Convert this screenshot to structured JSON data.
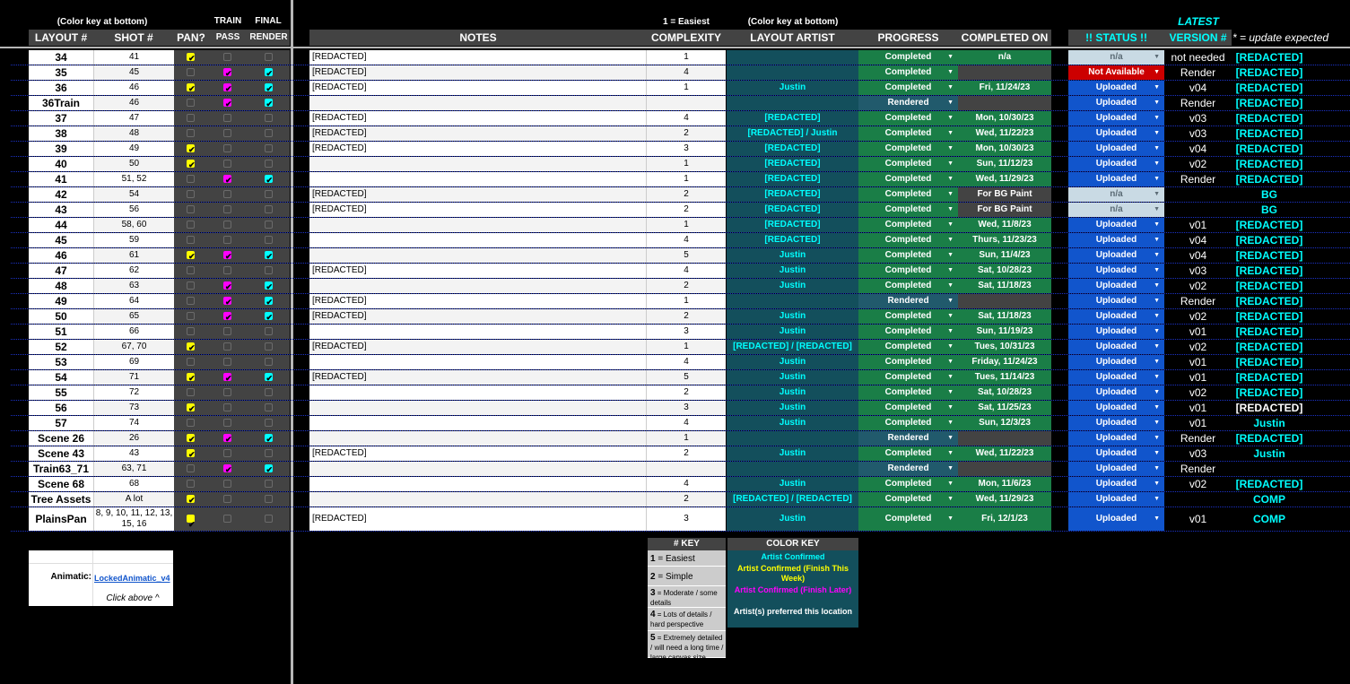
{
  "subheaders": {
    "color_key_left": "(Color key at bottom)",
    "train": "TRAIN",
    "final": "FINAL",
    "easiest": "1 = Easiest",
    "color_key_right": "(Color key at bottom)",
    "latest": "LATEST"
  },
  "headers": {
    "layout": "LAYOUT #",
    "shot": "SHOT #",
    "pan": "PAN?",
    "pass": "PASS",
    "render": "RENDER",
    "notes": "NOTES",
    "complexity": "COMPLEXITY",
    "artist": "LAYOUT ARTIST",
    "progress": "PROGRESS",
    "completed_on": "COMPLETED ON",
    "status": "!! STATUS !!",
    "version": "VERSION #",
    "update_note": "* = update expected"
  },
  "colors": {
    "green": "#1a7e47",
    "slate": "#215a6c",
    "dark": "#434343",
    "blue": "#1155cc",
    "red": "#cc0000",
    "light": "#c9dae4",
    "teal": "#134f5c",
    "cyan": "#00ffff",
    "yellow": "#ffff00",
    "magenta": "#ff00ff"
  },
  "rows": [
    {
      "layout": "34",
      "shot": "41",
      "pan": true,
      "train": false,
      "final": false,
      "notes": "[REDACTED]",
      "cx": "1",
      "artist": "",
      "progress": "Completed",
      "comp": "n/a",
      "comp_style": "green",
      "status": "n/a",
      "status_style": "light",
      "ver": "not needed",
      "extra": "[REDACTED]"
    },
    {
      "layout": "35",
      "shot": "45",
      "pan": false,
      "train": true,
      "final": true,
      "notes": "[REDACTED]",
      "cx": "4",
      "artist": "",
      "progress": "Completed",
      "comp": "",
      "comp_style": "dark",
      "status": "Not Available",
      "status_style": "red",
      "ver": "Render",
      "extra": "[REDACTED]"
    },
    {
      "layout": "36",
      "shot": "46",
      "pan": true,
      "train": true,
      "final": true,
      "notes": "[REDACTED]",
      "cx": "1",
      "artist": "Justin",
      "progress": "Completed",
      "comp": "Fri, 11/24/23",
      "comp_style": "green",
      "status": "Uploaded",
      "status_style": "blue",
      "ver": "v04",
      "extra": "[REDACTED]"
    },
    {
      "layout": "36Train",
      "shot": "46",
      "pan": false,
      "train": true,
      "final": true,
      "notes": "",
      "cx": "",
      "artist": "",
      "progress": "Rendered",
      "comp": "",
      "comp_style": "dark",
      "status": "Uploaded",
      "status_style": "blue",
      "ver": "Render",
      "extra": "[REDACTED]"
    },
    {
      "layout": "37",
      "shot": "47",
      "pan": false,
      "train": false,
      "final": false,
      "notes": "[REDACTED]",
      "cx": "4",
      "artist": "[REDACTED]",
      "progress": "Completed",
      "comp": "Mon, 10/30/23",
      "comp_style": "green",
      "status": "Uploaded",
      "status_style": "blue",
      "ver": "v03",
      "extra": "[REDACTED]"
    },
    {
      "layout": "38",
      "shot": "48",
      "pan": false,
      "train": false,
      "final": false,
      "notes": "[REDACTED]",
      "cx": "2",
      "artist": "[REDACTED] / Justin",
      "progress": "Completed",
      "comp": "Wed, 11/22/23",
      "comp_style": "green",
      "status": "Uploaded",
      "status_style": "blue",
      "ver": "v03",
      "extra": "[REDACTED]"
    },
    {
      "layout": "39",
      "shot": "49",
      "pan": true,
      "train": false,
      "final": false,
      "notes": "[REDACTED]",
      "cx": "3",
      "artist": "[REDACTED]",
      "progress": "Completed",
      "comp": "Mon, 10/30/23",
      "comp_style": "green",
      "status": "Uploaded",
      "status_style": "blue",
      "ver": "v04",
      "extra": "[REDACTED]"
    },
    {
      "layout": "40",
      "shot": "50",
      "pan": true,
      "train": false,
      "final": false,
      "notes": "",
      "cx": "1",
      "artist": "[REDACTED]",
      "progress": "Completed",
      "comp": "Sun, 11/12/23",
      "comp_style": "green",
      "status": "Uploaded",
      "status_style": "blue",
      "ver": "v02",
      "extra": "[REDACTED]"
    },
    {
      "layout": "41",
      "shot": "51, 52",
      "pan": false,
      "train": true,
      "final": true,
      "notes": "",
      "cx": "1",
      "artist": "[REDACTED]",
      "progress": "Completed",
      "comp": "Wed, 11/29/23",
      "comp_style": "green",
      "status": "Uploaded",
      "status_style": "blue",
      "ver": "Render",
      "extra": "[REDACTED]"
    },
    {
      "layout": "42",
      "shot": "54",
      "pan": false,
      "train": false,
      "final": false,
      "notes": "[REDACTED]",
      "cx": "2",
      "artist": "[REDACTED]",
      "progress": "Completed",
      "comp": "For BG Paint",
      "comp_style": "dark",
      "status": "n/a",
      "status_style": "light",
      "ver": "",
      "extra": "BG"
    },
    {
      "layout": "43",
      "shot": "56",
      "pan": false,
      "train": false,
      "final": false,
      "notes": "[REDACTED]",
      "cx": "2",
      "artist": "[REDACTED]",
      "progress": "Completed",
      "comp": "For BG Paint",
      "comp_style": "dark",
      "status": "n/a",
      "status_style": "light",
      "ver": "",
      "extra": "BG"
    },
    {
      "layout": "44",
      "shot": "58, 60",
      "pan": false,
      "train": false,
      "final": false,
      "notes": "",
      "cx": "1",
      "artist": "[REDACTED]",
      "progress": "Completed",
      "comp": "Wed, 11/8/23",
      "comp_style": "green",
      "status": "Uploaded",
      "status_style": "blue",
      "ver": "v01",
      "extra": "[REDACTED]"
    },
    {
      "layout": "45",
      "shot": "59",
      "pan": false,
      "train": false,
      "final": false,
      "notes": "",
      "cx": "4",
      "artist": "[REDACTED]",
      "progress": "Completed",
      "comp": "Thurs, 11/23/23",
      "comp_style": "green",
      "status": "Uploaded",
      "status_style": "blue",
      "ver": "v04",
      "extra": "[REDACTED]"
    },
    {
      "layout": "46",
      "shot": "61",
      "pan": true,
      "train": true,
      "final": true,
      "notes": "",
      "cx": "5",
      "artist": "Justin",
      "progress": "Completed",
      "comp": "Sun, 11/4/23",
      "comp_style": "green",
      "status": "Uploaded",
      "status_style": "blue",
      "ver": "v04",
      "extra": "[REDACTED]"
    },
    {
      "layout": "47",
      "shot": "62",
      "pan": false,
      "train": false,
      "final": false,
      "notes": "[REDACTED]",
      "cx": "4",
      "artist": "Justin",
      "progress": "Completed",
      "comp": "Sat, 10/28/23",
      "comp_style": "green",
      "status": "Uploaded",
      "status_style": "blue",
      "ver": "v03",
      "extra": "[REDACTED]"
    },
    {
      "layout": "48",
      "shot": "63",
      "pan": false,
      "train": true,
      "final": true,
      "notes": "",
      "cx": "2",
      "artist": "Justin",
      "progress": "Completed",
      "comp": "Sat, 11/18/23",
      "comp_style": "green",
      "status": "Uploaded",
      "status_style": "blue",
      "ver": "v02",
      "extra": "[REDACTED]"
    },
    {
      "layout": "49",
      "shot": "64",
      "pan": false,
      "train": true,
      "final": true,
      "notes": "[REDACTED]",
      "cx": "1",
      "artist": "",
      "progress": "Rendered",
      "comp": "",
      "comp_style": "dark",
      "status": "Uploaded",
      "status_style": "blue",
      "ver": "Render",
      "extra": "[REDACTED]"
    },
    {
      "layout": "50",
      "shot": "65",
      "pan": false,
      "train": true,
      "final": true,
      "notes": "[REDACTED]",
      "cx": "2",
      "artist": "Justin",
      "progress": "Completed",
      "comp": "Sat, 11/18/23",
      "comp_style": "green",
      "status": "Uploaded",
      "status_style": "blue",
      "ver": "v02",
      "extra": "[REDACTED]"
    },
    {
      "layout": "51",
      "shot": "66",
      "pan": false,
      "train": false,
      "final": false,
      "notes": "",
      "cx": "3",
      "artist": "Justin",
      "progress": "Completed",
      "comp": "Sun, 11/19/23",
      "comp_style": "green",
      "status": "Uploaded",
      "status_style": "blue",
      "ver": "v01",
      "extra": "[REDACTED]"
    },
    {
      "layout": "52",
      "shot": "67, 70",
      "pan": true,
      "train": false,
      "final": false,
      "notes": "[REDACTED]",
      "cx": "1",
      "artist": "[REDACTED] / [REDACTED]",
      "progress": "Completed",
      "comp": "Tues, 10/31/23",
      "comp_style": "green",
      "status": "Uploaded",
      "status_style": "blue",
      "ver": "v02",
      "extra": "[REDACTED]"
    },
    {
      "layout": "53",
      "shot": "69",
      "pan": false,
      "train": false,
      "final": false,
      "notes": "",
      "cx": "4",
      "artist": "Justin",
      "progress": "Completed",
      "comp": "Friday, 11/24/23",
      "comp_style": "green",
      "status": "Uploaded",
      "status_style": "blue",
      "ver": "v01",
      "extra": "[REDACTED]"
    },
    {
      "layout": "54",
      "shot": "71",
      "pan": true,
      "train": true,
      "final": true,
      "notes": "[REDACTED]",
      "cx": "5",
      "artist": "Justin",
      "progress": "Completed",
      "comp": "Tues, 11/14/23",
      "comp_style": "green",
      "status": "Uploaded",
      "status_style": "blue",
      "ver": "v01",
      "extra": "[REDACTED]"
    },
    {
      "layout": "55",
      "shot": "72",
      "pan": false,
      "train": false,
      "final": false,
      "notes": "",
      "cx": "2",
      "artist": "Justin",
      "progress": "Completed",
      "comp": "Sat, 10/28/23",
      "comp_style": "green",
      "status": "Uploaded",
      "status_style": "blue",
      "ver": "v02",
      "extra": "[REDACTED]"
    },
    {
      "layout": "56",
      "shot": "73",
      "pan": true,
      "train": false,
      "final": false,
      "notes": "",
      "cx": "3",
      "artist": "Justin",
      "progress": "Completed",
      "comp": "Sat, 11/25/23",
      "comp_style": "green",
      "status": "Uploaded",
      "status_style": "blue",
      "ver": "v01",
      "extra": "[REDACTED]",
      "extra_white": true
    },
    {
      "layout": "57",
      "shot": "74",
      "pan": false,
      "train": false,
      "final": false,
      "notes": "",
      "cx": "4",
      "artist": "Justin",
      "progress": "Completed",
      "comp": "Sun, 12/3/23",
      "comp_style": "green",
      "status": "Uploaded",
      "status_style": "blue",
      "ver": "v01",
      "extra": "Justin"
    },
    {
      "layout": "Scene 26",
      "shot": "26",
      "pan": true,
      "train": true,
      "final": true,
      "notes": "",
      "cx": "1",
      "artist": "",
      "progress": "Rendered",
      "comp": "",
      "comp_style": "dark",
      "status": "Uploaded",
      "status_style": "blue",
      "ver": "Render",
      "extra": "[REDACTED]"
    },
    {
      "layout": "Scene 43",
      "shot": "43",
      "pan": true,
      "train": false,
      "final": false,
      "notes": "[REDACTED]",
      "cx": "2",
      "artist": "Justin",
      "progress": "Completed",
      "comp": "Wed, 11/22/23",
      "comp_style": "green",
      "status": "Uploaded",
      "status_style": "blue",
      "ver": "v03",
      "extra": "Justin"
    },
    {
      "layout": "Train63_71",
      "shot": "63, 71",
      "pan": false,
      "train": true,
      "final": true,
      "notes": "",
      "cx": "",
      "artist": "",
      "progress": "Rendered",
      "comp": "",
      "comp_style": "dark",
      "status": "Uploaded",
      "status_style": "blue",
      "ver": "Render",
      "extra": ""
    },
    {
      "layout": "Scene 68",
      "shot": "68",
      "pan": false,
      "train": false,
      "final": false,
      "notes": "",
      "cx": "4",
      "artist": "Justin",
      "progress": "Completed",
      "comp": "Mon, 11/6/23",
      "comp_style": "green",
      "status": "Uploaded",
      "status_style": "blue",
      "ver": "v02",
      "extra": "[REDACTED]"
    },
    {
      "layout": "Tree Assets",
      "shot": "A lot",
      "pan": true,
      "train": false,
      "final": false,
      "notes": "",
      "cx": "2",
      "artist": "[REDACTED] / [REDACTED]",
      "progress": "Completed",
      "comp": "Wed, 11/29/23",
      "comp_style": "green",
      "status": "Uploaded",
      "status_style": "blue",
      "ver": "",
      "extra": "COMP"
    },
    {
      "layout": "PlainsPan",
      "shot": "8, 9, 10, 11, 12, 13, 15, 16",
      "pan": true,
      "train": false,
      "final": false,
      "notes": "[REDACTED]",
      "cx": "3",
      "artist": "Justin",
      "progress": "Completed",
      "comp": "Fri, 12/1/23",
      "comp_style": "green",
      "status": "Uploaded",
      "status_style": "blue",
      "ver": "v01",
      "extra": "COMP",
      "tall": true
    }
  ],
  "animatic": {
    "label": "Animatic:",
    "link": "LockedAnimatic_v4",
    "hint": "Click above ^"
  },
  "num_key": {
    "title": "# KEY",
    "items": [
      {
        "num": "1",
        "text": "= Easiest"
      },
      {
        "num": "2",
        "text": "= Simple"
      },
      {
        "num": "3",
        "text": "= Moderate / some details"
      },
      {
        "num": "4",
        "text": "= Lots of details / hard perspective"
      },
      {
        "num": "5",
        "text": "= Extremely detailed / will need a long time / large canvas size"
      }
    ]
  },
  "color_key": {
    "title": "COLOR KEY",
    "items": [
      {
        "text": "Artist Confirmed",
        "color": "#00ffff"
      },
      {
        "text": "Artist Confirmed (Finish This Week)",
        "color": "#ffff00"
      },
      {
        "text": "Artist Confirmed (Finish Later)",
        "color": "#ff00ff"
      },
      {
        "text": "Artist(s) preferred this location",
        "color": "#ffffff"
      }
    ]
  }
}
